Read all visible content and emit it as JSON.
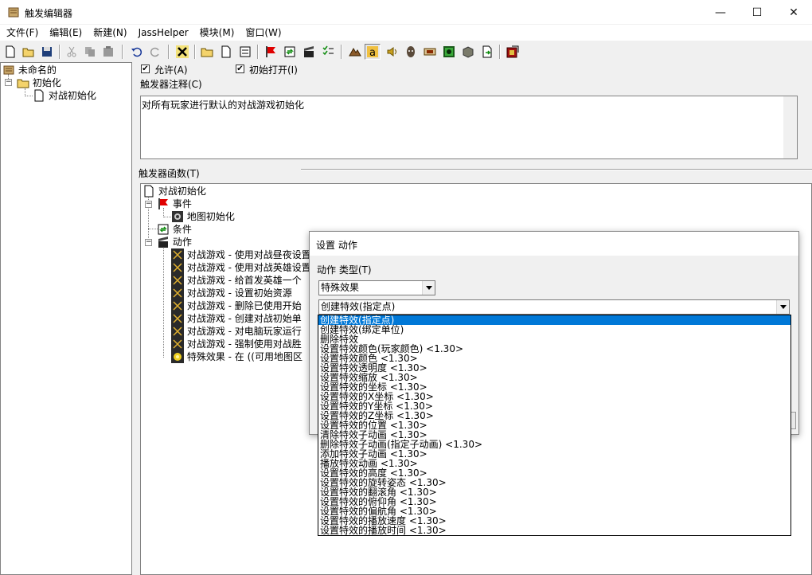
{
  "window": {
    "title": "触发编辑器",
    "buttons": {
      "minimize": "—",
      "maximize": "☐",
      "close": "✕"
    }
  },
  "menu": [
    "文件(F)",
    "编辑(E)",
    "新建(N)",
    "JassHelper",
    "模块(M)",
    "窗口(W)"
  ],
  "toolbar_icons": [
    "new-icon",
    "open-icon",
    "save-icon",
    "cut-icon",
    "copy-icon",
    "paste-icon",
    "undo-icon",
    "redo-icon",
    "delete-icon",
    "new-category-icon",
    "new-trigger-icon",
    "new-comment-icon",
    "new-event-icon",
    "new-condition-icon",
    "new-action-icon",
    "new-variable-icon",
    "terrain-icon",
    "triggers-icon",
    "sound-icon",
    "object-icon",
    "campaign-icon",
    "ai-icon",
    "object-manager-icon",
    "import-icon",
    "test-map-icon"
  ],
  "left_tree": {
    "root": "未命名的",
    "category": "初始化",
    "trigger": "对战初始化"
  },
  "trigger_panel": {
    "enabled_label": "允许(A)",
    "initially_on_label": "初始打开(I)",
    "comment_label": "触发器注释(C)",
    "comment_text": "对所有玩家进行默认的对战游戏初始化",
    "functions_label": "触发器函数(T)",
    "functions": {
      "root": "对战初始化",
      "events_label": "事件",
      "event_item": "地图初始化",
      "conditions_label": "条件",
      "actions_label": "动作",
      "actions": [
        "对战游戏 - 使用对战昼夜设置",
        "对战游戏 - 使用对战英雄设置",
        "对战游戏 - 给首发英雄一个",
        "对战游戏 - 设置初始资源",
        "对战游戏 - 删除已使用开始",
        "对战游戏 - 创建对战初始单",
        "对战游戏 - 对电脑玩家运行",
        "对战游戏 - 强制使用对战胜",
        "特殊效果 - 在 ((可用地图区"
      ]
    }
  },
  "dialog": {
    "title": "设置 动作",
    "type_label": "动作 类型(T)",
    "category_value": "特殊效果",
    "action_value": "创建特效(指定点)",
    "options": [
      "创建特效(指定点)",
      "创建特效(绑定单位)",
      "删除特效",
      "设置特效颜色(玩家颜色) <1.30>",
      "设置特效颜色 <1.30>",
      "设置特效透明度 <1.30>",
      "设置特效缩放 <1.30>",
      "设置特效的坐标 <1.30>",
      "设置特效的X坐标 <1.30>",
      "设置特效的Y坐标 <1.30>",
      "设置特效的Z坐标 <1.30>",
      "设置特效的位置 <1.30>",
      "清除特效子动画 <1.30>",
      "删除特效子动画(指定子动画) <1.30>",
      "添加特效子动画 <1.30>",
      "播放特效动画 <1.30>",
      "设置特效的高度 <1.30>",
      "设置特效的旋转姿态 <1.30>",
      "设置特效的翻滚角 <1.30>",
      "设置特效的俯仰角 <1.30>",
      "设置特效的偏航角 <1.30>",
      "设置特效的播放速度 <1.30>",
      "设置特效的播放时间 <1.30>"
    ],
    "selected_index": 0
  }
}
